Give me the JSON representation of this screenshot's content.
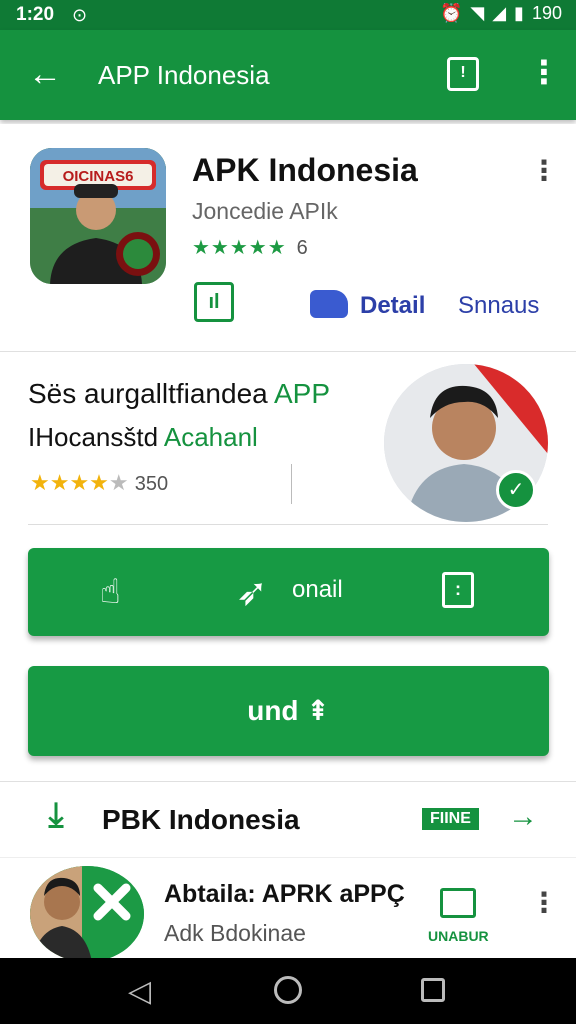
{
  "status": {
    "time": "1:20",
    "battery": "190"
  },
  "appbar": {
    "title": "APP Indonesia",
    "bag_glyph": "!"
  },
  "hero": {
    "app_name": "APK Indonesia",
    "developer": "Joncedie APIk",
    "rating_count": "6",
    "icon_banner_text": "OICINAS6",
    "chat_glyph": "ıl",
    "detail_label": "Detail",
    "second_label": "Snnaus"
  },
  "feature": {
    "line1_dark": "Sës aurgalltfiandea",
    "line1_green": "APP",
    "line2_dark": "IHocansštd",
    "line2_green": "Acahanl",
    "rating_count": "350"
  },
  "buttons": {
    "primary_label": "onail",
    "install_label": "und ⇞"
  },
  "list": {
    "item1_title": "PBK Indonesia",
    "item1_tag": "FIINE",
    "item2_title": "Abtaila: APRK aPPÇ",
    "item2_subtitle": "Adk Bdokinae",
    "item2_action": "UNABUR"
  },
  "colors": {
    "primary_green": "#15923f",
    "dark_green": "#0f7a35",
    "link_blue": "#2c3fa8",
    "star_yellow": "#f2b30c"
  }
}
